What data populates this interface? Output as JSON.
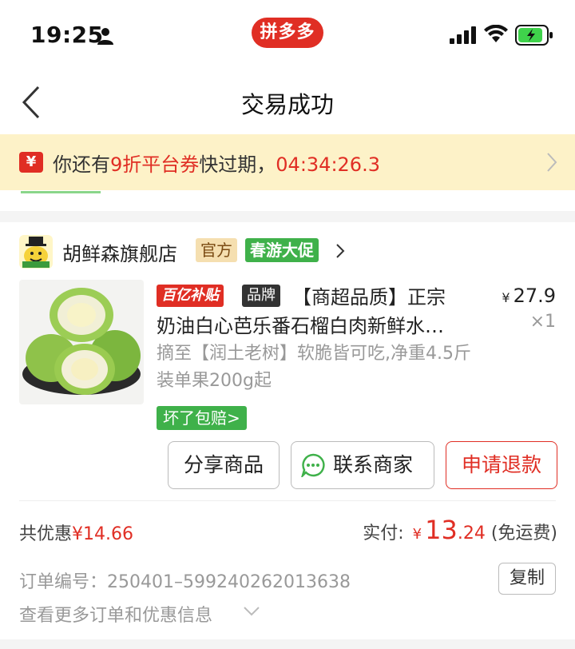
{
  "status_bar": {
    "time": "19:25",
    "app_badge": "拼多多"
  },
  "nav": {
    "title": "交易成功"
  },
  "banner": {
    "icon_glyph": "¥",
    "prefix": "你还有",
    "coupon": "9折平台券",
    "middle": "快过期，",
    "countdown": "04:34:26.3"
  },
  "store": {
    "name": "胡鲜森旗舰店",
    "tag_official": "官方",
    "tag_promo": "春游大促"
  },
  "product": {
    "badge_subsidy": "百亿补贴",
    "badge_brand": "品牌",
    "title_line1": "【商超品质】正宗",
    "title_line2": "奶油白心芭乐番石榴白肉新鲜水…",
    "spec": "摘至【润土老树】软脆皆可吃,净重4.5斤装单果200g起",
    "price_symbol": "¥",
    "price": "27.9",
    "qty": "×1",
    "guarantee": "坏了包赔>"
  },
  "actions": {
    "share": "分享商品",
    "contact": "联系商家",
    "refund": "申请退款"
  },
  "summary": {
    "discount_label": "共优惠",
    "discount_value": "¥14.66",
    "paid_label": "实付:",
    "paid_symbol": "¥",
    "paid_int": "13",
    "paid_dec": ".24",
    "paid_note": "(免运费)"
  },
  "order_info": {
    "order_no": "订单编号：250401–599240262013638",
    "copy": "复制",
    "more": "查看更多订单和优惠信息"
  },
  "colors": {
    "brand_red": "#e02e24",
    "promo_green": "#3fb14a",
    "banner_bg": "#fdf2c8"
  }
}
